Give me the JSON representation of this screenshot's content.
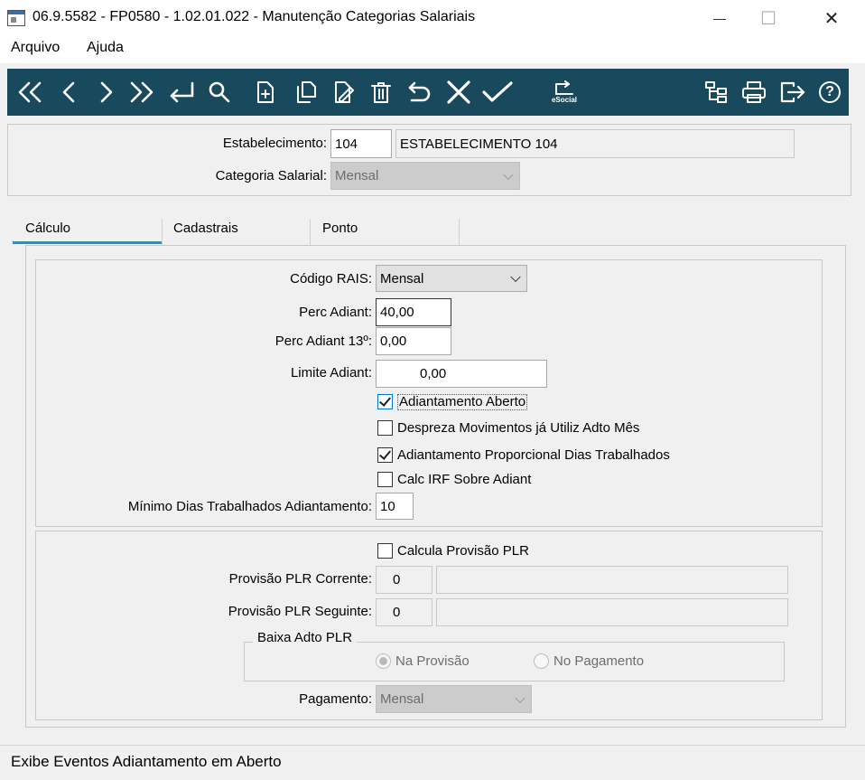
{
  "window": {
    "title": "06.9.5582 - FP0580 - 1.02.01.022 - Manutenção Categorias Salariais",
    "minimize_glyph": "—",
    "maximize_glyph": "☐",
    "close_glyph": "✕"
  },
  "menu": {
    "file": "Arquivo",
    "help": "Ajuda"
  },
  "toolbar": {
    "esocial_label": "eSocial",
    "help_glyph": "?",
    "background": "#19495c"
  },
  "header": {
    "estabelecimento_label": "Estabelecimento:",
    "estabelecimento_code": "104",
    "estabelecimento_name": "ESTABELECIMENTO 104",
    "categoria_label": "Categoria Salarial:",
    "categoria_value": "Mensal"
  },
  "tabs": [
    {
      "label": "Cálculo",
      "active": true
    },
    {
      "label": "Cadastrais",
      "active": false
    },
    {
      "label": "Ponto",
      "active": false
    }
  ],
  "calculo": {
    "codigo_rais_label": "Código RAIS:",
    "codigo_rais_value": "Mensal",
    "perc_adiant_label": "Perc Adiant:",
    "perc_adiant_value": "40,00",
    "perc_adiant13_label": "Perc Adiant 13º:",
    "perc_adiant13_value": "0,00",
    "limite_adiant_label": "Limite Adiant:",
    "limite_adiant_value": "0,00",
    "checkboxes": [
      {
        "label": "Adiantamento Aberto",
        "checked": true
      },
      {
        "label": "Despreza Movimentos já Utiliz Adto Mês",
        "checked": false
      },
      {
        "label": "Adiantamento Proporcional Dias Trabalhados",
        "checked": true
      },
      {
        "label": "Calc IRF Sobre Adiant",
        "checked": false
      }
    ],
    "minimo_dias_label": "Mínimo Dias Trabalhados Adiantamento:",
    "minimo_dias_value": "10"
  },
  "plr": {
    "calcula_label": "Calcula Provisão PLR",
    "calcula_checked": false,
    "corrente_label": "Provisão PLR Corrente:",
    "corrente_code": "0",
    "corrente_desc": "",
    "seguinte_label": "Provisão PLR Seguinte:",
    "seguinte_code": "0",
    "seguinte_desc": "",
    "baixa_group_label": "Baixa Adto PLR",
    "radio_provisao": "Na Provisão",
    "radio_pagamento": "No Pagamento",
    "radio_selected": "Na Provisão",
    "pagamento_label": "Pagamento:",
    "pagamento_value": "Mensal"
  },
  "status": {
    "text": "Exibe Eventos Adiantamento em Aberto"
  },
  "colors": {
    "accent": "#0078d7",
    "toolbar": "#19495c"
  }
}
